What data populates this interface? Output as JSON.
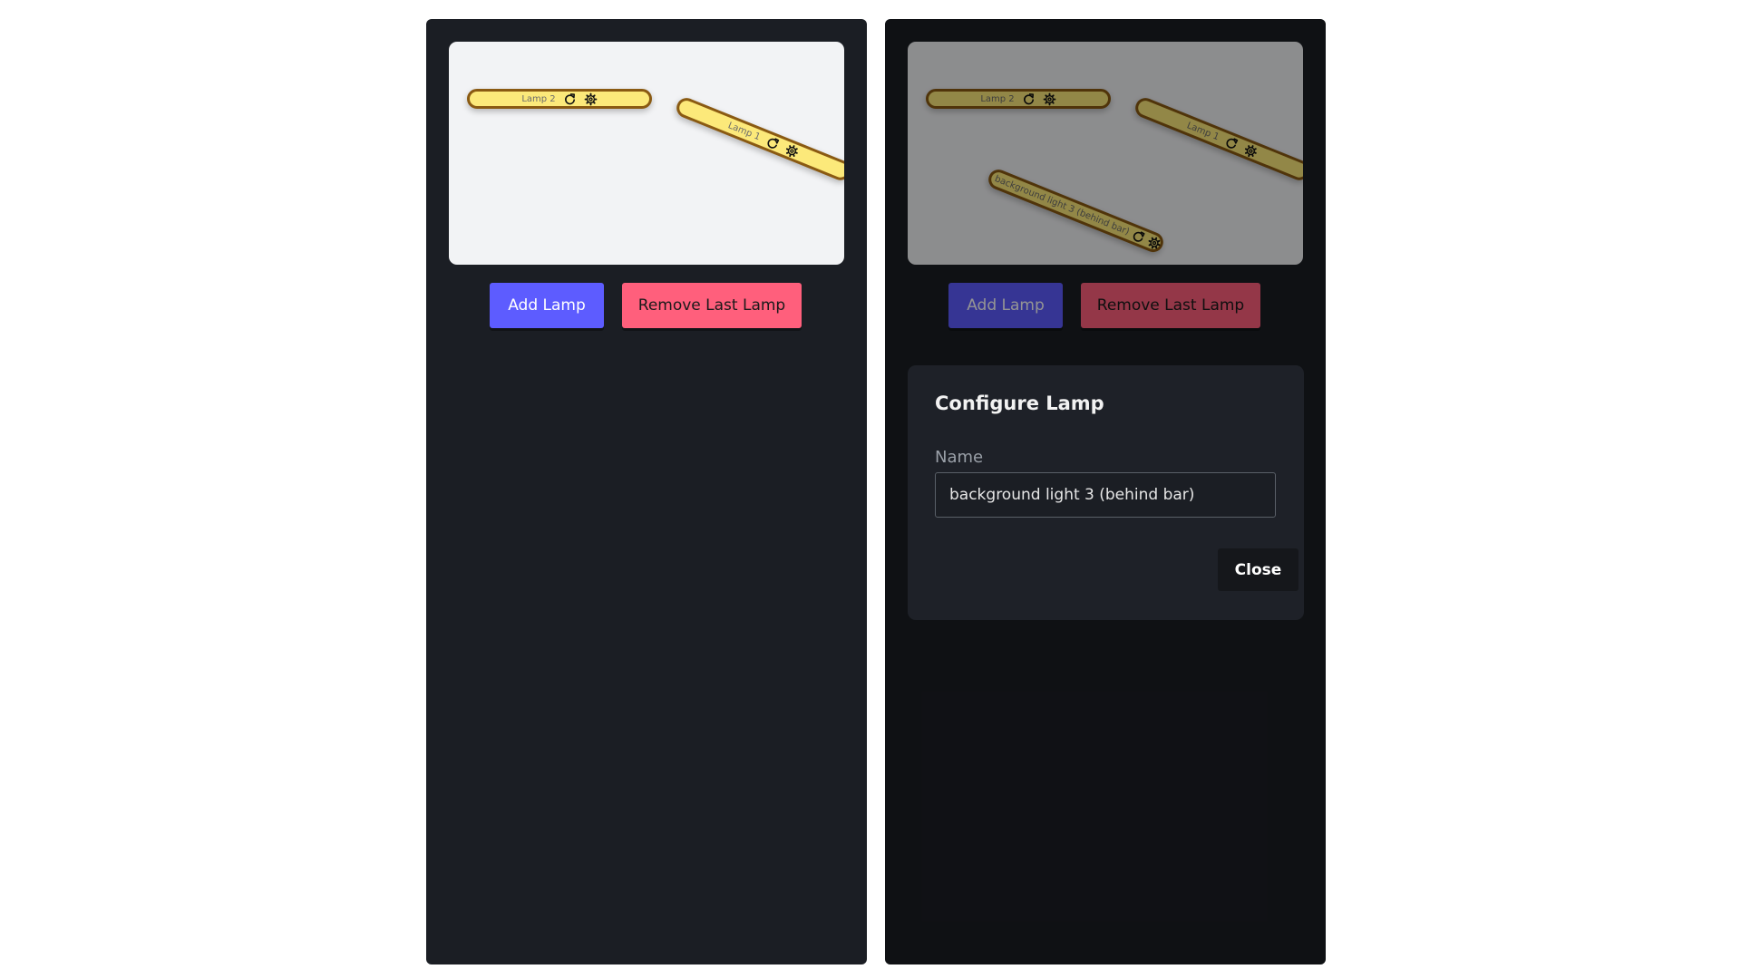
{
  "colors": {
    "panel_bg": "#1b1e24",
    "canvas_bg": "#f2f3f5",
    "lamp_fill": "#fce97a",
    "lamp_border": "#8a5a12",
    "add_button": "#5d5cff",
    "remove_button": "#ff5f7c",
    "modal_bg": "#1e2128"
  },
  "left_panel": {
    "lamps": [
      {
        "label": "Lamp 2",
        "icons": [
          "rotate-icon",
          "gear-icon"
        ]
      },
      {
        "label": "Lamp 1",
        "icons": [
          "rotate-icon",
          "gear-icon"
        ]
      }
    ],
    "add_label": "Add Lamp",
    "remove_label": "Remove Last Lamp"
  },
  "right_panel": {
    "lamps": [
      {
        "label": "Lamp 2",
        "icons": [
          "rotate-icon",
          "gear-icon"
        ]
      },
      {
        "label": "Lamp 1",
        "icons": [
          "rotate-icon",
          "gear-icon"
        ]
      },
      {
        "label": "background light 3 (behind bar)",
        "icons": [
          "rotate-icon",
          "gear-icon"
        ]
      }
    ],
    "add_label": "Add Lamp",
    "remove_label": "Remove Last Lamp",
    "modal": {
      "title": "Configure Lamp",
      "name_label": "Name",
      "name_value": "background light 3 (behind bar)",
      "close_label": "Close"
    }
  }
}
